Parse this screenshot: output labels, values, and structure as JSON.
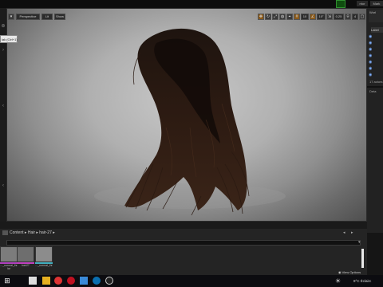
{
  "viewport": {
    "perspective_label": "Perspective",
    "lit_label": "Lit",
    "show_label": "Show",
    "grid_snap": "10",
    "rotation_snap": "10°",
    "scale_snap": "0.25",
    "camera_speed": "4"
  },
  "tooltip": {
    "text": "lak (Ctrl+1)"
  },
  "content_browser": {
    "breadcrumb": [
      "Content",
      "Hair",
      "hair-27"
    ],
    "assets": [
      {
        "label_line1": "..._normal_lhr",
        "label_line2": "lar",
        "color_bar": "#b040c0"
      },
      {
        "label_line1": "hair27",
        "label_line2": "",
        "color_bar": "#c040c0"
      },
      {
        "label_line1": "..._normal_lhr",
        "label_line2": "",
        "color_bar": "#40b0c0"
      }
    ],
    "view_options": "View Options"
  },
  "outliner": {
    "header": "Worl",
    "label": "Label",
    "items_count": "17 actors"
  },
  "details": {
    "header": "Deta"
  },
  "top": {
    "label_a": "ntor",
    "label_b": "Mark"
  },
  "taskbar": {
    "tray_text": "8°C  Éclairc"
  },
  "colors": {
    "accent": "#2f8f2f",
    "viewport_bg": "#b0b0b0",
    "hair": "#2a1a12"
  }
}
